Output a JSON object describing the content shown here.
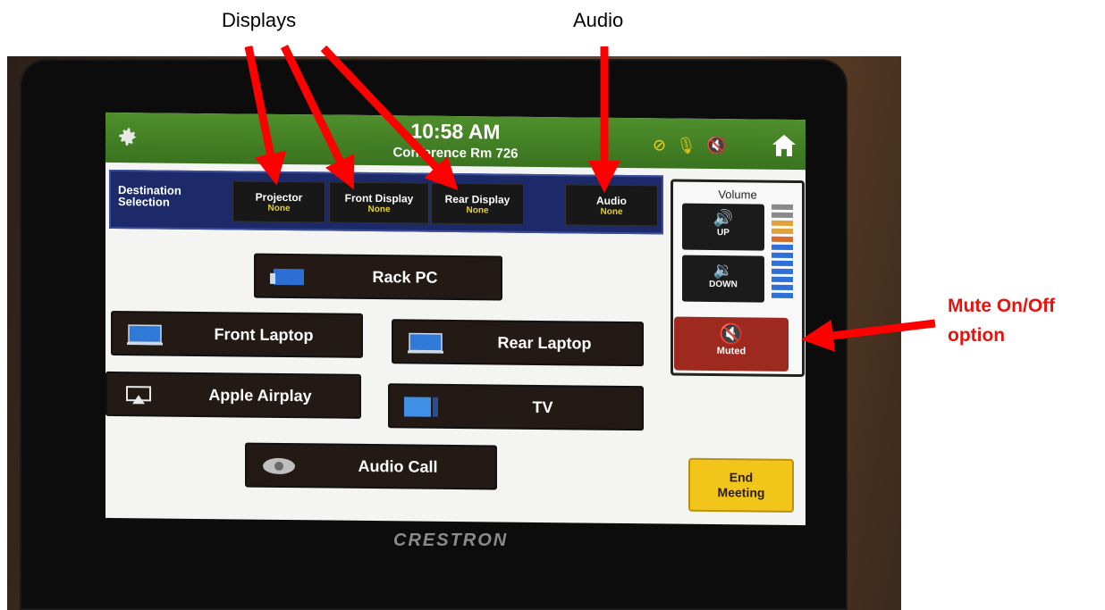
{
  "annotations": {
    "displays_label": "Displays",
    "audio_label": "Audio",
    "mute_label_line1": "Mute On/Off",
    "mute_label_line2": "option"
  },
  "header": {
    "time": "10:58 AM",
    "room": "Conference Rm 726",
    "icons": [
      "settings-gear-icon",
      "no-video-icon",
      "microphone-icon",
      "speaker-muted-icon",
      "home-icon"
    ],
    "bar_color": "#3f7a22"
  },
  "destination": {
    "title": "Destination Selection",
    "buttons": [
      {
        "label": "Projector",
        "status": "None"
      },
      {
        "label": "Front Display",
        "status": "None"
      },
      {
        "label": "Rear Display",
        "status": "None"
      },
      {
        "label": "Audio",
        "status": "None"
      }
    ]
  },
  "volume": {
    "title": "Volume",
    "up_label": "UP",
    "down_label": "DOWN",
    "mute_label": "Muted",
    "mute_color": "#9e2a1f"
  },
  "sources": [
    {
      "label": "Rack PC",
      "icon": "rack-pc-icon"
    },
    {
      "label": "Front Laptop",
      "icon": "laptop-icon"
    },
    {
      "label": "Rear Laptop",
      "icon": "laptop-icon"
    },
    {
      "label": "Apple Airplay",
      "icon": "airplay-icon"
    },
    {
      "label": "TV",
      "icon": "tv-icon"
    },
    {
      "label": "Audio Call",
      "icon": "telephone-icon"
    }
  ],
  "end_meeting": {
    "line1": "End",
    "line2": "Meeting",
    "color": "#f2c51a"
  },
  "brand": "CRESTRON",
  "arrow_color": "#ff0000"
}
